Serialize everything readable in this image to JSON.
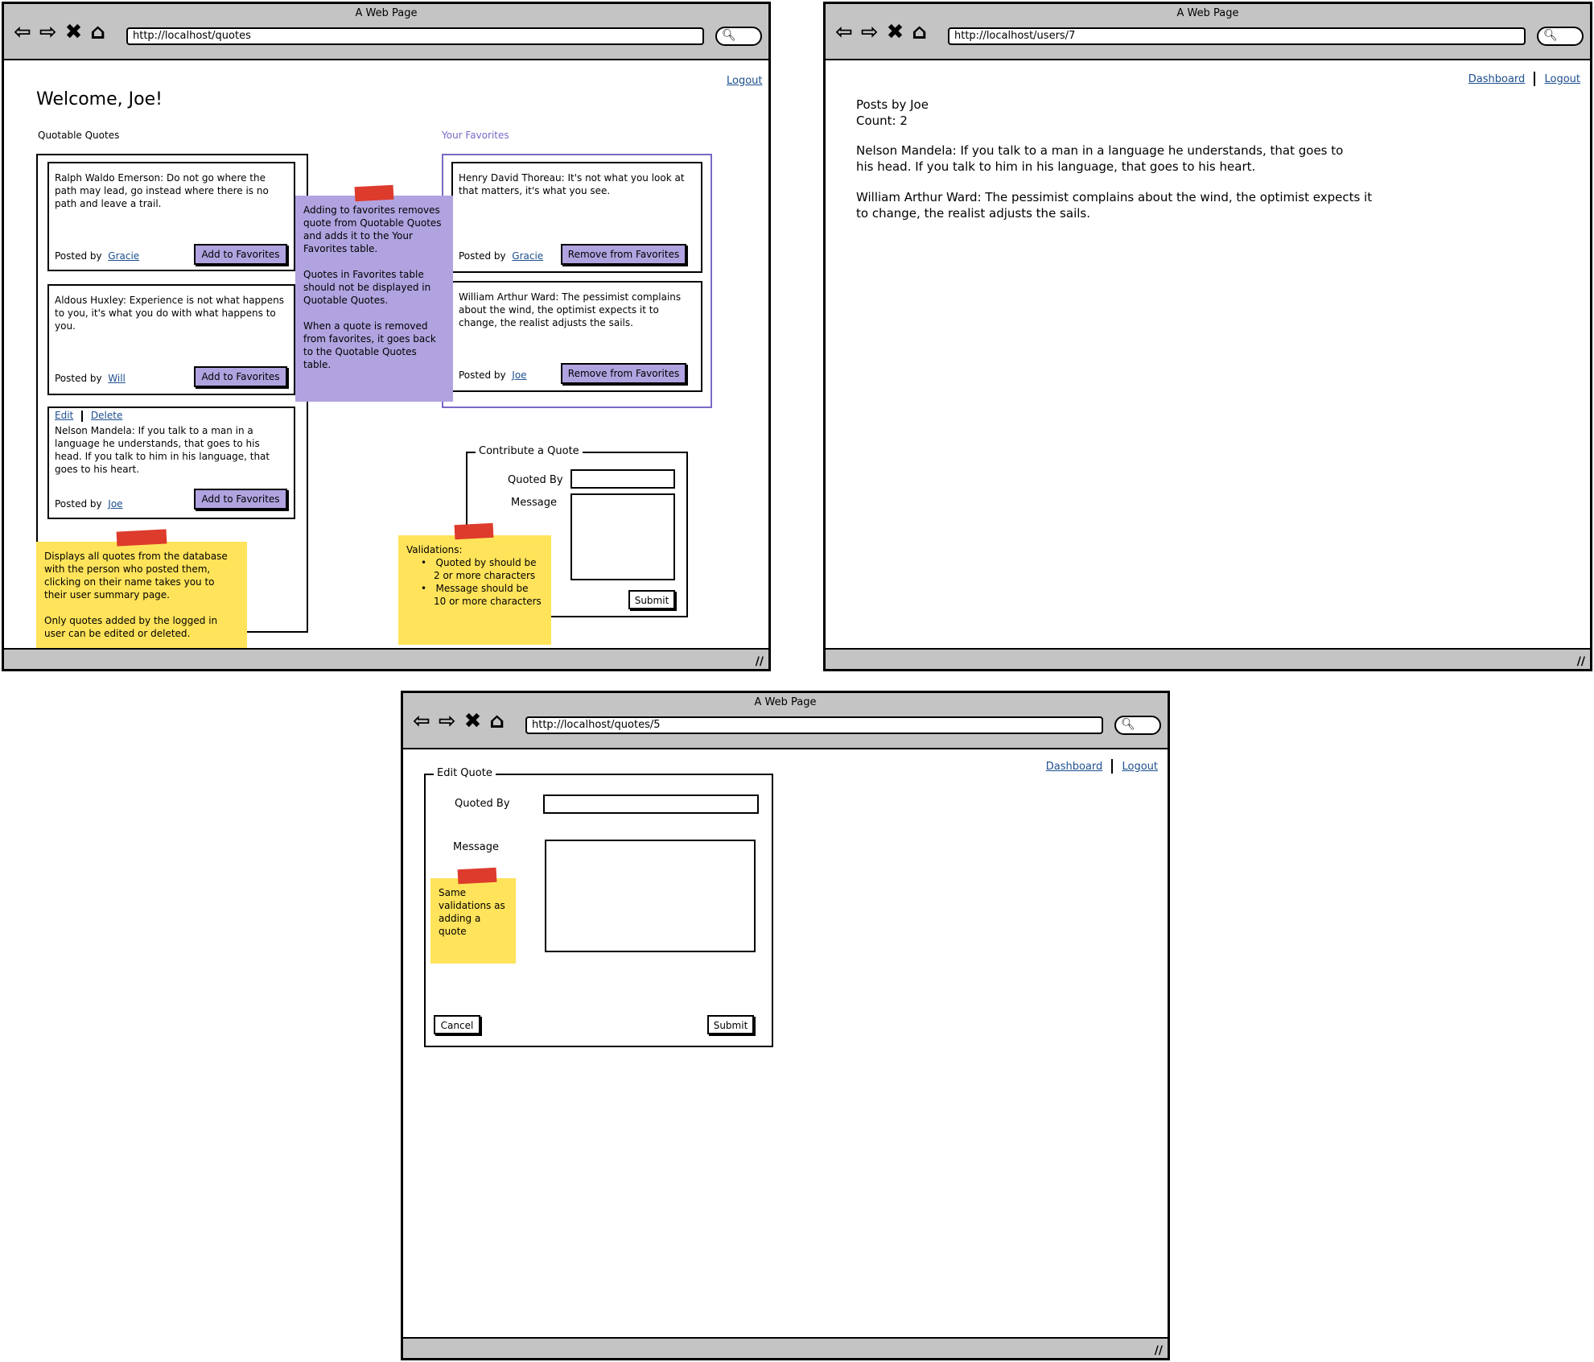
{
  "window_title": "A Web Page",
  "icons": {
    "back": "back-arrow-icon",
    "forward": "forward-arrow-icon",
    "stop": "close-icon",
    "home": "home-icon",
    "search": "search-icon",
    "resize": "resize-grip-icon"
  },
  "colors": {
    "chrome": "#c4c4c4",
    "purple": "#b1a3e0",
    "yellow_note": "#ffe35a",
    "tape": "#dd3b2c",
    "link": "#1d4f8f",
    "favorites_border": "#7b68c8"
  },
  "quotes_page": {
    "url": "http://localhost/quotes",
    "logout": "Logout",
    "welcome": "Welcome, Joe!",
    "quotable_title": "Quotable Quotes",
    "favorites_title": "Your Favorites",
    "posted_by": "Posted by",
    "quotes": [
      {
        "text": "Ralph Waldo Emerson: Do not go where the path may lead, go instead where there is no path and leave a trail.",
        "author": "Gracie",
        "button": "Add to Favorites"
      },
      {
        "text": "Aldous Huxley: Experience is not what happens to you, it's what you do with what happens to you.",
        "author": "Will",
        "button": "Add to Favorites"
      },
      {
        "text": "Nelson Mandela: If you talk to a man in a language he understands, that goes to his head. If you talk to him in his language, that goes to his heart.",
        "author": "Joe",
        "button": "Add to Favorites",
        "edit": "Edit",
        "delete": "Delete"
      }
    ],
    "favorites": [
      {
        "text": "Henry David Thoreau: It's not what you look at that matters, it's what you see.",
        "author": "Gracie",
        "button": "Remove from Favorites"
      },
      {
        "text": "William Arthur Ward: The pessimist complains about the wind, the optimist expects it to change, the realist adjusts the sails.",
        "author": "Joe",
        "button": "Remove from Favorites"
      }
    ],
    "contribute": {
      "legend": "Contribute a Quote",
      "quoted_by": "Quoted By",
      "message": "Message",
      "submit": "Submit"
    },
    "note_purple": {
      "p1": "Adding to favorites removes quote from Quotable Quotes and adds it to the Your Favorites table.",
      "p2": "Quotes in Favorites table should not be displayed in Quotable Quotes.",
      "p3": "When a quote is removed from favorites, it goes back to the Quotable Quotes table."
    },
    "note_yellow": {
      "p1": "Displays all quotes from the database with the person who posted them, clicking on their name takes you to their user summary page.",
      "p2": "Only quotes added by the logged in user can be edited or deleted."
    },
    "note_validations": {
      "title": "Validations:",
      "items": [
        "Quoted by should be 2 or more characters",
        "Message should be 10 or more characters"
      ]
    }
  },
  "user_page": {
    "url": "http://localhost/users/7",
    "dashboard": "Dashboard",
    "logout": "Logout",
    "heading": "Posts by Joe",
    "count": "Count: 2",
    "posts": [
      "Nelson Mandela: If you talk to a man in a language he understands, that goes to his head. If you talk to him in his language, that goes to his heart.",
      "William Arthur Ward: The pessimist complains about the wind, the optimist expects it to change, the realist adjusts the sails."
    ]
  },
  "edit_page": {
    "url": "http://localhost/quotes/5",
    "dashboard": "Dashboard",
    "logout": "Logout",
    "legend": "Edit Quote",
    "quoted_by": "Quoted By",
    "message": "Message",
    "cancel": "Cancel",
    "submit": "Submit",
    "note": "Same validations as adding a quote"
  }
}
